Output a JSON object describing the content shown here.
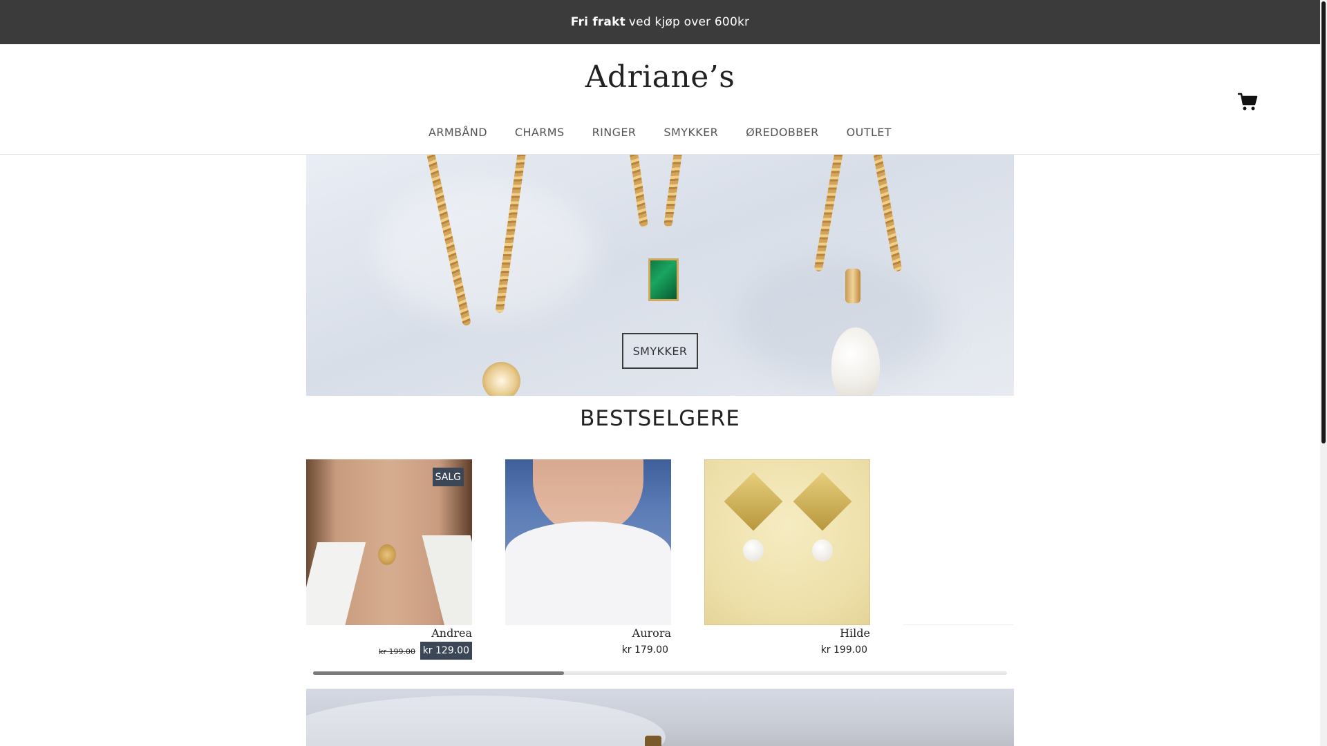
{
  "announcement": {
    "bold": "Fri frakt",
    "text": "ved kjøp over 600kr"
  },
  "header": {
    "logo": "Adriane’s",
    "cart_icon": "shopping-cart-icon"
  },
  "nav": {
    "items": [
      "ARMBÅND",
      "CHARMS",
      "RINGER",
      "SMYKKER",
      "ØREDOBBER",
      "OUTLET"
    ]
  },
  "hero": {
    "button_label": "SMYKKER"
  },
  "bestsellers": {
    "title": "BESTSELGERE",
    "products": [
      {
        "name": "Andrea",
        "badge": "SALG",
        "old_price": "kr 199.00",
        "price": "kr 129.00"
      },
      {
        "name": "Aurora",
        "price": "kr 179.00"
      },
      {
        "name": "Hilde",
        "price": "kr 199.00"
      }
    ]
  },
  "colors": {
    "announcement_bg": "#3b3b3b",
    "badge_bg": "#3b4656",
    "text": "#222222"
  }
}
